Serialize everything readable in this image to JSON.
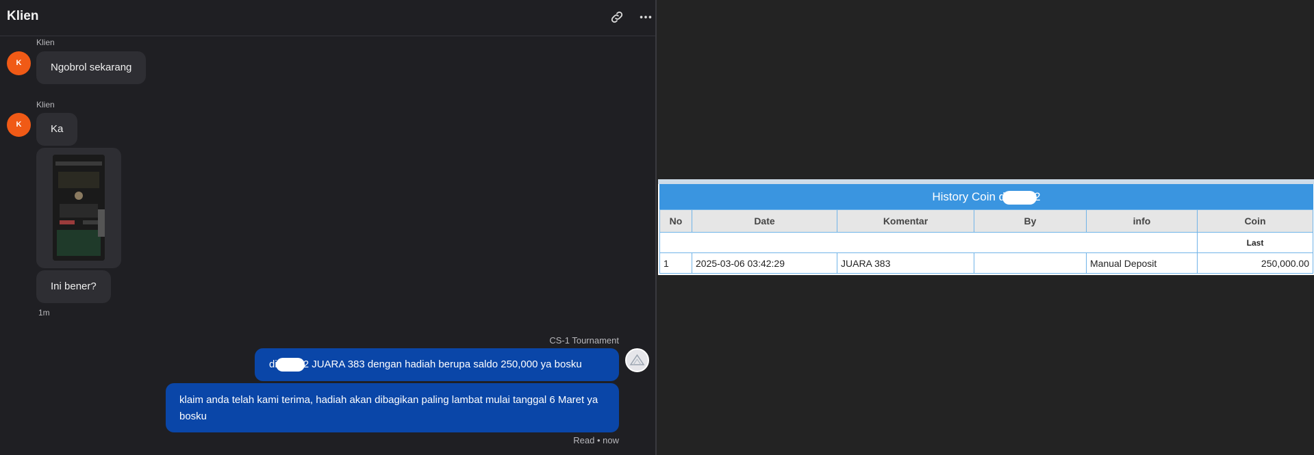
{
  "chat": {
    "header": {
      "title": "Klien",
      "link_icon": "link-icon",
      "more_icon": "more-horizontal-icon"
    },
    "messages": [
      {
        "sender": "Klien",
        "avatar_initial": "K",
        "text": "Ngobrol sekarang"
      },
      {
        "sender": "Klien",
        "avatar_initial": "K",
        "text": "Ka"
      },
      {
        "type": "image",
        "description": "phone-screenshot-thumbnail"
      },
      {
        "text": "Ini bener?",
        "time": "1m"
      }
    ],
    "agent": {
      "name": "CS-1 Tournament",
      "message_1_prefix": "di",
      "message_1_suffix": "2 JUARA 383 dengan hadiah berupa saldo 250,000 ya bosku",
      "message_2": "klaim anda telah kami terima, hadiah akan dibagikan paling lambat mulai tanggal 6 Maret ya bosku",
      "status": "Read • now"
    }
  },
  "history": {
    "title_prefix": "History Coin d",
    "title_suffix": "2",
    "columns": [
      "No",
      "Date",
      "Komentar",
      "By",
      "info",
      "Coin"
    ],
    "last_label": "Last",
    "rows": [
      {
        "no": "1",
        "date": "2025-03-06 03:42:29",
        "komentar": "JUARA 383",
        "by": "",
        "info": "Manual Deposit",
        "coin": "250,000.00"
      }
    ]
  },
  "colors": {
    "accent": "#0a46a8",
    "avatar": "#f05a16",
    "table_header": "#3a95e0",
    "coin": "#2e8b2e"
  }
}
